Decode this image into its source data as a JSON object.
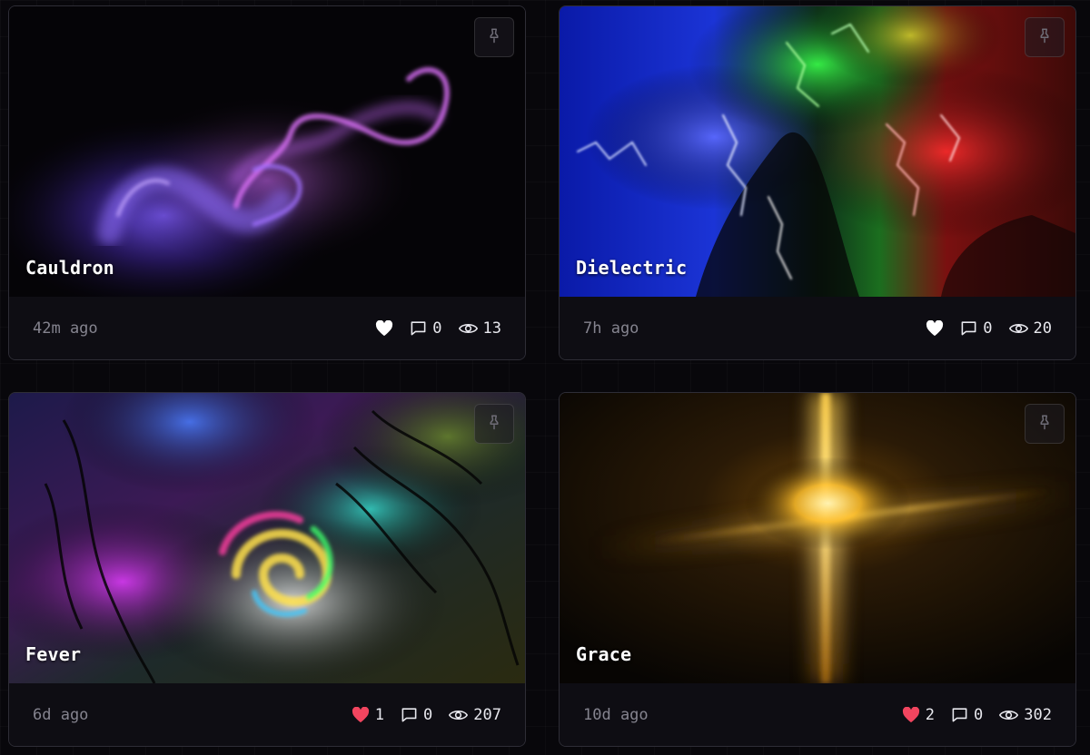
{
  "cards": [
    {
      "title": "Cauldron",
      "time": "42m ago",
      "likes": "",
      "liked": false,
      "comments": "0",
      "views": "13",
      "thumb": "purple-smoke"
    },
    {
      "title": "Dielectric",
      "time": "7h ago",
      "likes": "",
      "liked": false,
      "comments": "0",
      "views": "20",
      "thumb": "rgb-lightning"
    },
    {
      "title": "Fever",
      "time": "6d ago",
      "likes": "1",
      "liked": true,
      "comments": "0",
      "views": "207",
      "thumb": "rainbow-swirl"
    },
    {
      "title": "Grace",
      "time": "10d ago",
      "likes": "2",
      "liked": true,
      "comments": "0",
      "views": "302",
      "thumb": "golden-cross"
    }
  ],
  "icons": {
    "pin": "pin-icon",
    "heart": "heart-icon",
    "comment": "comment-icon",
    "views": "eye-icon"
  },
  "colors": {
    "background": "#08070b",
    "card": "#0e0d13",
    "border": "#2e2d36",
    "liked_heart": "#f2455f",
    "heart": "#ffffff",
    "muted_text": "#85848f"
  }
}
